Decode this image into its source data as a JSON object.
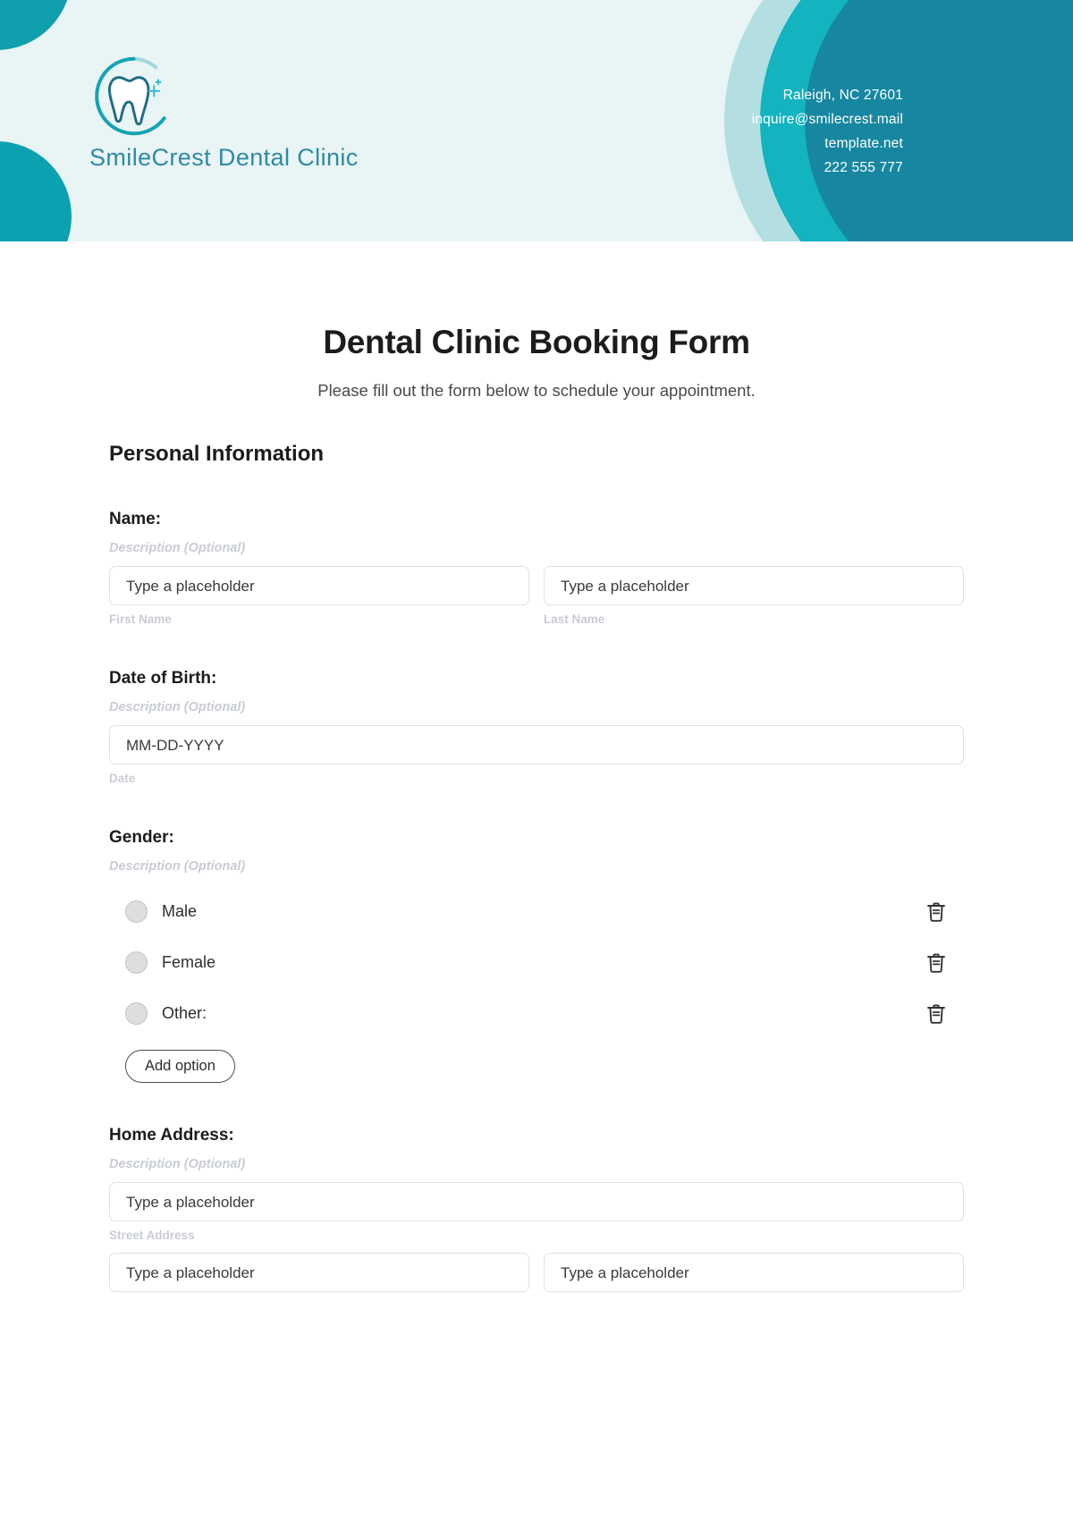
{
  "header": {
    "logo_icon": "tooth-in-circle-icon",
    "clinic_name": "SmileCrest Dental Clinic",
    "contact_lines": [
      "Raleigh, NC 27601",
      "inquire@smilecrest.mail",
      "template.net",
      "222 555 777"
    ],
    "colors": {
      "background": "#e9f4f5",
      "accent_light": "#b3dfe3",
      "accent_bright": "#13b3c0",
      "accent_dark": "#1787a1",
      "logo_text": "#2f8aa3"
    }
  },
  "form": {
    "title": "Dental Clinic Booking Form",
    "subtitle": "Please fill out the form below to schedule your appointment.",
    "section_title": "Personal Information",
    "description_placeholder": "Description (Optional)",
    "fields": [
      {
        "label": "Name:",
        "description": "Description (Optional)",
        "type": "two-column-text",
        "inputs": [
          {
            "value": "Type a placeholder",
            "sub_label": "First Name"
          },
          {
            "value": "Type a placeholder",
            "sub_label": "Last Name"
          }
        ]
      },
      {
        "label": "Date of Birth:",
        "description": "Description (Optional)",
        "type": "date",
        "inputs": [
          {
            "value": "MM-DD-YYYY",
            "sub_label": "Date"
          }
        ]
      },
      {
        "label": "Gender:",
        "description": "Description (Optional)",
        "type": "radio-group",
        "options": [
          {
            "label": "Male",
            "delete_icon": "trash-icon"
          },
          {
            "label": "Female",
            "delete_icon": "trash-icon"
          },
          {
            "label": "Other:",
            "delete_icon": "trash-icon"
          }
        ],
        "add_option_label": "Add option"
      },
      {
        "label": "Home Address:",
        "description": "Description (Optional)",
        "type": "address",
        "inputs": [
          {
            "value": "Type a placeholder",
            "sub_label": "Street Address"
          },
          {
            "value": "Type a placeholder",
            "sub_label": ""
          },
          {
            "value": "Type a placeholder",
            "sub_label": ""
          }
        ]
      }
    ]
  }
}
